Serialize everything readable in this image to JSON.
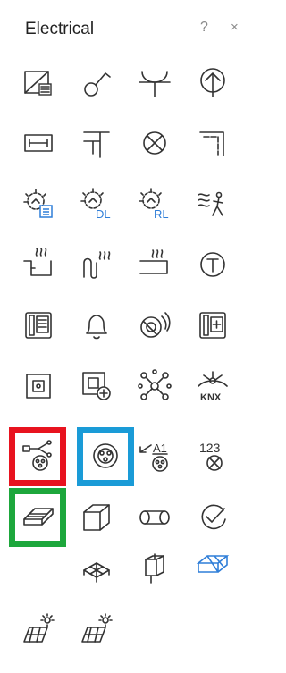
{
  "panel": {
    "title": "Electrical",
    "help_label": "?",
    "close_label": "×"
  },
  "icons": {
    "label_dl": "DL",
    "label_rl": "RL",
    "label_knx": "KNX",
    "label_a1": "A1",
    "label_123": "123"
  },
  "selection_colors": {
    "red": "#e8131f",
    "blue": "#1a9bd7",
    "green": "#1da73c"
  }
}
